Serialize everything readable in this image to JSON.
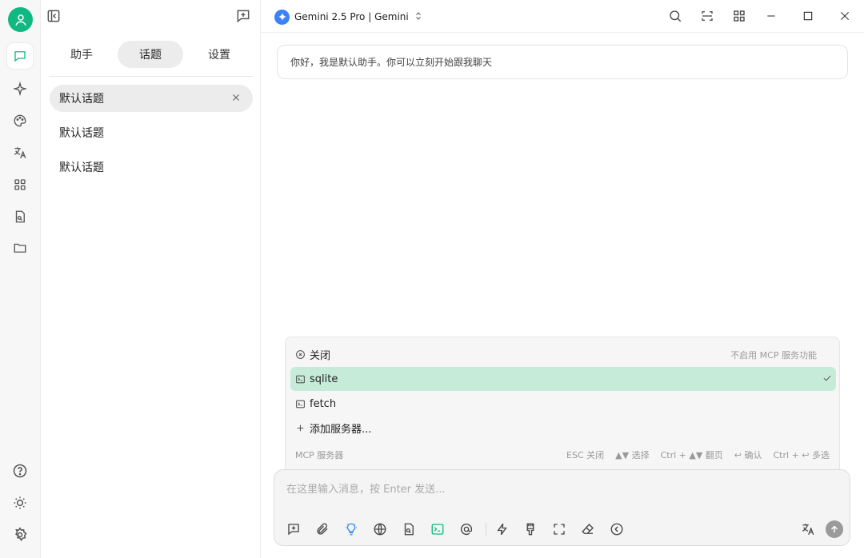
{
  "app": {
    "model_name": "Gemini 2.5 Pro | Gemini",
    "accent_color": "#10b981",
    "avatar_color": "#10b981"
  },
  "rail": {
    "top_icons": [
      "chat-icon",
      "sparkle-icon",
      "palette-icon",
      "translate-icon",
      "apps-icon",
      "file-search-icon",
      "folder-icon"
    ],
    "bottom_icons": [
      "help-icon",
      "theme-icon",
      "settings-icon"
    ]
  },
  "sidebar": {
    "tabs": [
      {
        "label": "助手"
      },
      {
        "label": "话题",
        "active": true
      },
      {
        "label": "设置"
      }
    ],
    "topics": [
      {
        "label": "默认话题",
        "active": true
      },
      {
        "label": "默认话题"
      },
      {
        "label": "默认话题"
      }
    ]
  },
  "chat": {
    "greeting": "你好，我是默认助手。你可以立刻开始跟我聊天"
  },
  "mcp": {
    "items": [
      {
        "label": "关闭",
        "icon": "circle-x-icon",
        "desc": "不启用 MCP 服务功能"
      },
      {
        "label": "sqlite",
        "icon": "terminal-icon",
        "selected": true
      },
      {
        "label": "fetch",
        "icon": "terminal-icon"
      },
      {
        "label": "添加服务器...",
        "icon": "plus-icon"
      }
    ],
    "footer_title": "MCP 服务器",
    "hints": [
      "ESC 关闭",
      "▲▼ 选择",
      "Ctrl + ▲▼ 翻页",
      "↩ 确认",
      "Ctrl + ↩ 多选"
    ]
  },
  "input": {
    "placeholder": "在这里输入消息，按 Enter 发送..."
  },
  "toolbar_icons": [
    "new-topic-icon",
    "attach-icon",
    "bulb-icon",
    "globe-icon",
    "file-icon",
    "terminal-icon",
    "at-icon",
    "lightning-icon",
    "brush-icon",
    "fullscreen-icon",
    "eraser-icon",
    "collapse-icon",
    "translate-icon",
    "send-icon"
  ]
}
